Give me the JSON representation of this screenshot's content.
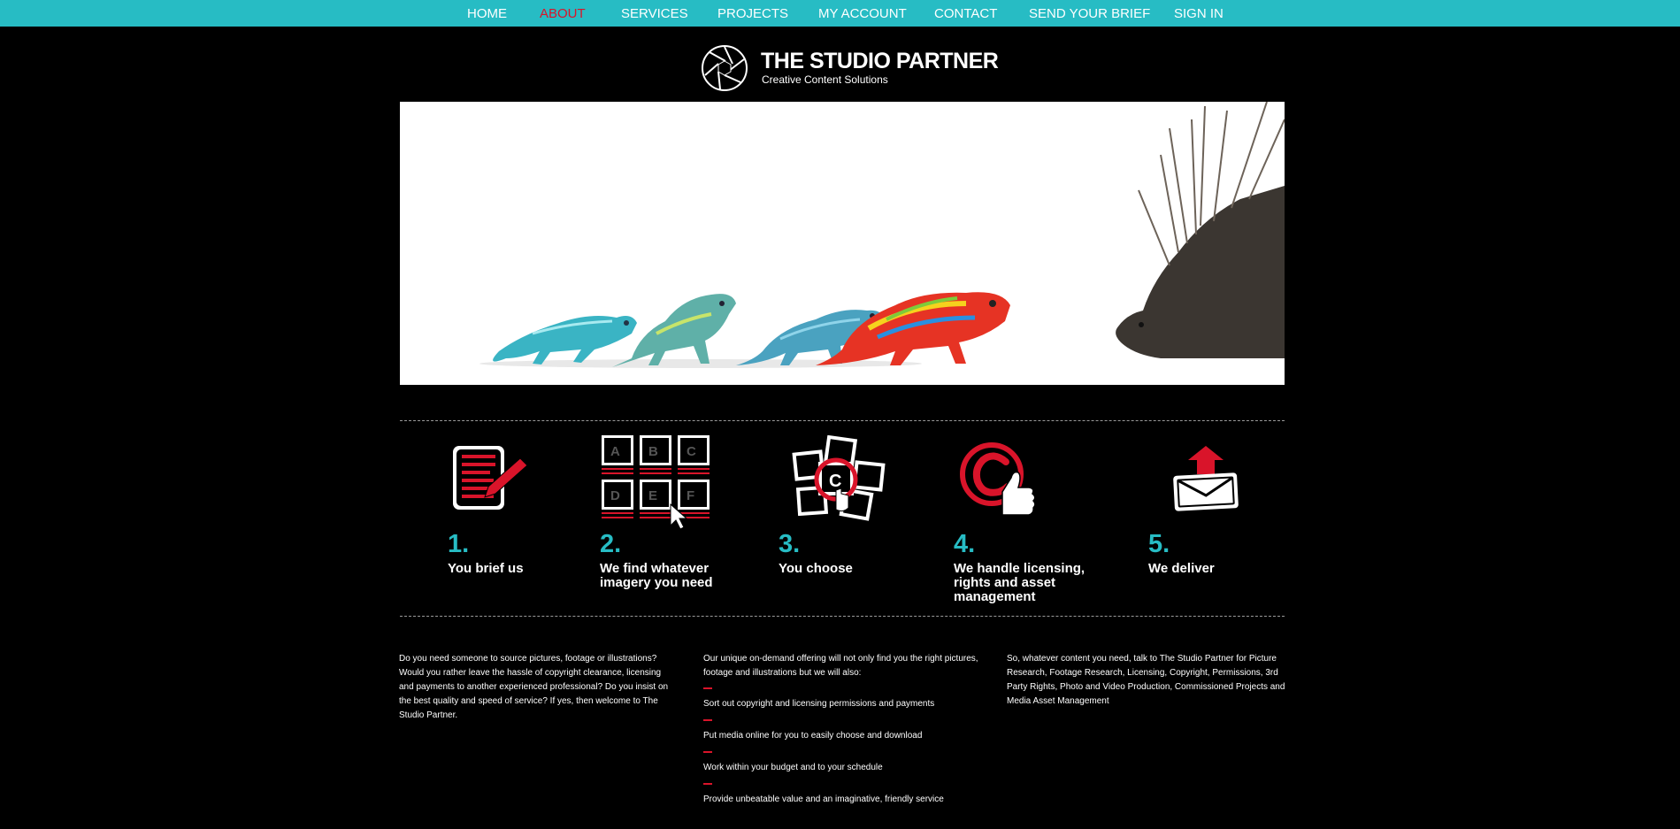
{
  "nav": {
    "items": [
      {
        "label": "HOME",
        "active": false
      },
      {
        "label": "ABOUT",
        "active": true
      },
      {
        "label": "SERVICES",
        "active": false
      },
      {
        "label": "PROJECTS",
        "active": false
      },
      {
        "label": "MY ACCOUNT",
        "active": false
      },
      {
        "label": "CONTACT",
        "active": false
      },
      {
        "label": "SEND YOUR BRIEF",
        "active": false
      },
      {
        "label": "SIGN IN",
        "active": false
      }
    ]
  },
  "brand": {
    "name": "THE STUDIO PARTNER",
    "tagline": "Creative Content Solutions"
  },
  "colors": {
    "nav_bg": "#27bcc4",
    "accent_red": "#d9142a",
    "step_number": "#27bcc4"
  },
  "steps": [
    {
      "number": "1.",
      "label": "You brief us",
      "icon": "brief-pad-icon"
    },
    {
      "number": "2.",
      "label": "We find whatever imagery you need",
      "icon": "image-grid-icon",
      "grid_letters": [
        "A",
        "B",
        "C",
        "D",
        "E",
        "F"
      ]
    },
    {
      "number": "3.",
      "label": "You choose",
      "icon": "choose-photos-icon",
      "choice_letter": "C"
    },
    {
      "number": "4.",
      "label": "We handle licensing, rights and asset management",
      "icon": "copyright-thumbs-up-icon"
    },
    {
      "number": "5.",
      "label": "We deliver",
      "icon": "envelope-upload-icon"
    }
  ],
  "intro": {
    "left": "Do you need someone to source pictures, footage or illustrations? Would you rather leave the hassle of copyright clearance, licensing and payments to another experienced professional? Do you insist on the best quality and speed of service? If yes, then welcome to The Studio Partner.",
    "middle_intro": "Our unique on-demand offering will not only find you the right pictures, footage and illustrations but we will also:",
    "middle_list": [
      "Sort out copyright and licensing permissions and payments",
      "Put media online for you to easily choose and download",
      "Work within your budget and to your schedule",
      "Provide unbeatable value and an imaginative, friendly service"
    ],
    "right": "So, whatever content you need, talk to The Studio Partner for Picture Research, Footage Research, Licensing, Copyright, Permissions, 3rd Party Rights, Photo and Video Production, Commissioned Projects and Media Asset Management"
  }
}
